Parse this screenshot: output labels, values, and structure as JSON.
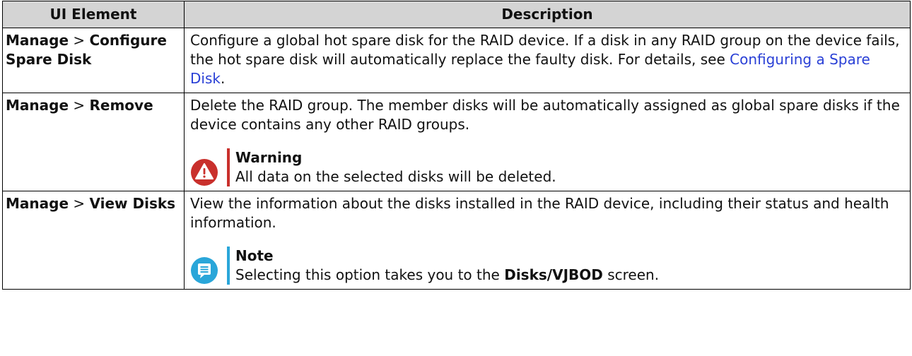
{
  "table": {
    "headers": [
      "UI Element",
      "Description"
    ],
    "separator": ">",
    "rows": [
      {
        "ui_main": "Manage",
        "ui_sub": "Configure Spare Disk",
        "desc_text": "Configure a global hot spare disk for the RAID device. If a disk in any RAID group on the device fails, the hot spare disk will automatically replace the faulty disk. For details, see ",
        "desc_link": "Configuring a Spare Disk",
        "desc_end": "."
      },
      {
        "ui_main": "Manage",
        "ui_sub": "Remove",
        "desc_text": "Delete the RAID group. The member disks will be automatically assigned as global spare disks if the device contains any other RAID groups.",
        "callout": {
          "type": "warning",
          "title": "Warning",
          "text": "All data on the selected disks will be deleted.",
          "icon": "warning-icon",
          "color": "#c9302c"
        }
      },
      {
        "ui_main": "Manage",
        "ui_sub": "View Disks",
        "desc_text": "View the information about the disks installed in the RAID device, including their status and health information.",
        "callout": {
          "type": "note",
          "title": "Note",
          "text_before": "Selecting this option takes you to the ",
          "text_bold": "Disks/VJBOD",
          "text_after": " screen.",
          "icon": "note-icon",
          "color": "#2aa6d9"
        }
      }
    ]
  }
}
